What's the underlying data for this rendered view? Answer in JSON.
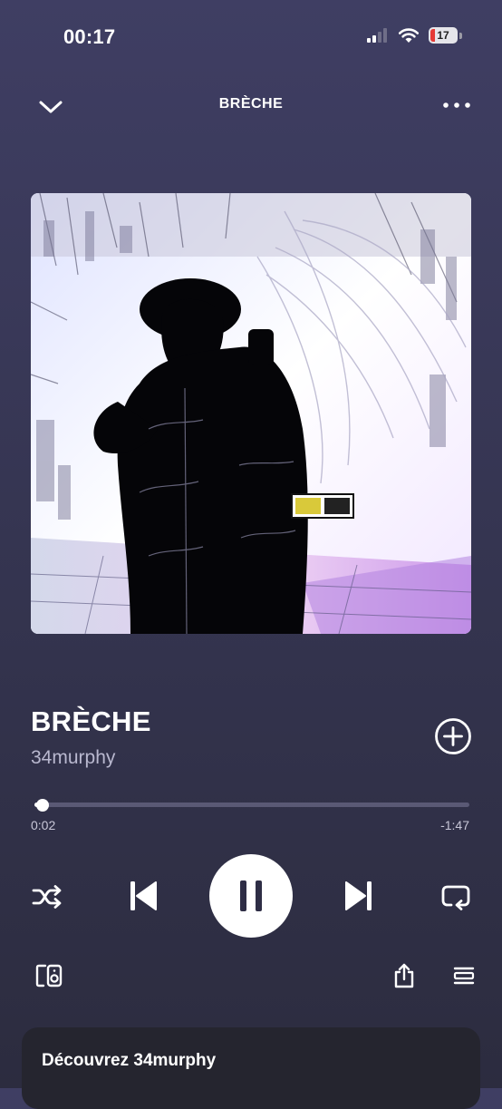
{
  "status_bar": {
    "time": "00:17",
    "battery_level": "17",
    "icons": [
      "cellular-signal-icon",
      "wifi-icon",
      "battery-icon"
    ]
  },
  "header": {
    "title": "BRÈCHE",
    "left_icon": "chevron-down-icon",
    "right_icon": "more-options-icon"
  },
  "track": {
    "title": "BRÈCHE",
    "artist": "34murphy",
    "add_icon": "add-circle-icon"
  },
  "progress": {
    "elapsed": "0:02",
    "remaining": "-1:47",
    "fraction": 0.018
  },
  "controls": {
    "shuffle_icon": "shuffle-icon",
    "previous_icon": "skip-previous-icon",
    "pause_icon": "pause-icon",
    "next_icon": "skip-next-icon",
    "repeat_icon": "repeat-icon"
  },
  "footer": {
    "devices_icon": "connect-device-icon",
    "share_icon": "share-icon",
    "queue_icon": "queue-icon"
  },
  "discover": {
    "label": "Découvrez 34murphy"
  },
  "colors": {
    "background_top": "#3f3e63",
    "background_bottom": "#2c2c3f",
    "artist_text": "#b9b8cf",
    "progress_track": "#5a5975",
    "battery_low": "#e53935"
  }
}
